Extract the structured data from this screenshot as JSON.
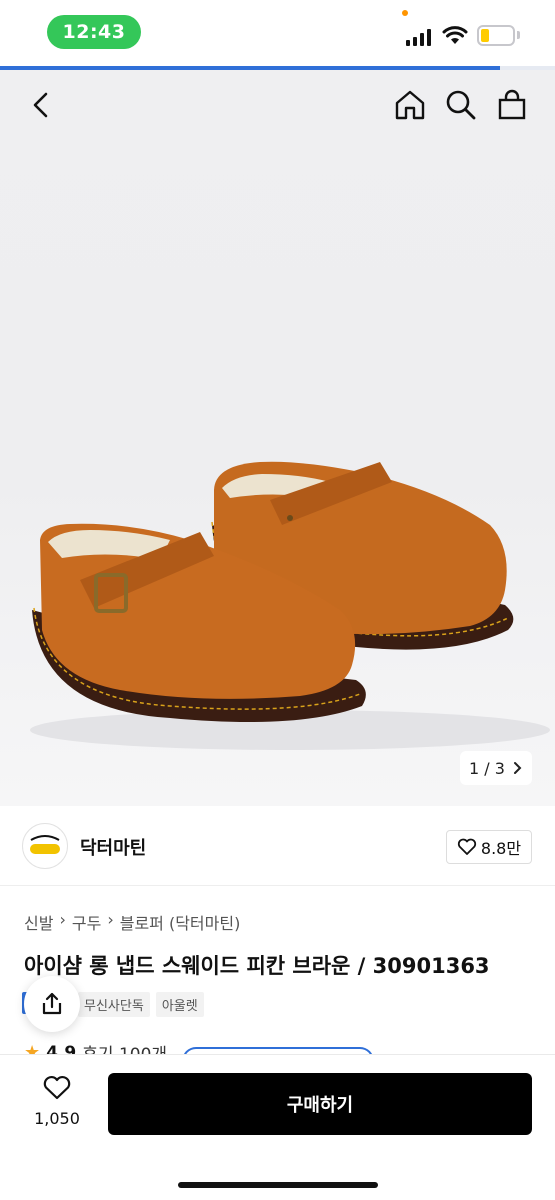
{
  "status_bar": {
    "time": "12:43",
    "colors": {
      "time_pill": "#34c759",
      "battery": "#ffcc00",
      "dot": "#ff9500"
    }
  },
  "top_progress": 0.9,
  "header": {
    "icons": [
      "back-icon",
      "home-icon",
      "search-icon",
      "bag-icon"
    ]
  },
  "gallery": {
    "current": "1",
    "separator": "/",
    "total": "3"
  },
  "brand": {
    "name": "닥터마틴",
    "likes": "8.8만"
  },
  "breadcrumb": [
    "신발",
    "구두",
    "블로퍼 (닥터마틴)"
  ],
  "product": {
    "title": "아이샴 롱 냅드 스웨이드 피칸 브라운 / 30901363",
    "tags": [
      "무신사단독",
      "아울렛"
    ],
    "rating": "4.9",
    "reviews": "후기 100개"
  },
  "bottom_bar": {
    "wish_count": "1,050",
    "buy_label": "구매하기"
  },
  "accent_color": "#2f6fd8"
}
